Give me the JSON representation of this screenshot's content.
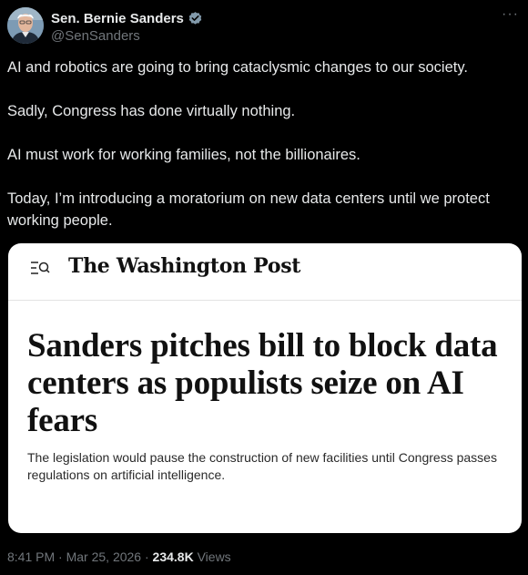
{
  "author": {
    "display_name": "Sen. Bernie Sanders",
    "handle": "@SenSanders",
    "verified_color": "#829aab"
  },
  "more_menu": "···",
  "tweet": {
    "paragraphs": [
      "AI and robotics are going to bring cataclysmic changes to our society.",
      "Sadly, Congress has done virtually nothing.",
      "AI must work for working families, not the billionaires.",
      "Today, I’m introducing a moratorium on new data centers until we protect working people."
    ]
  },
  "card": {
    "publication": "The Washington Post",
    "headline": "Sanders pitches bill to block data centers as populists seize on AI fears",
    "dek": "The legislation would pause the construction of new facilities until Congress passes regulations on artificial intelligence."
  },
  "meta": {
    "time": "8:41 PM",
    "separator": "·",
    "date": "Mar 25, 2026",
    "views_count": "234.8K",
    "views_label": "Views"
  },
  "colors": {
    "background": "#000000",
    "text_primary": "#e7e9ea",
    "text_secondary": "#71767b",
    "card_background": "#ffffff"
  }
}
